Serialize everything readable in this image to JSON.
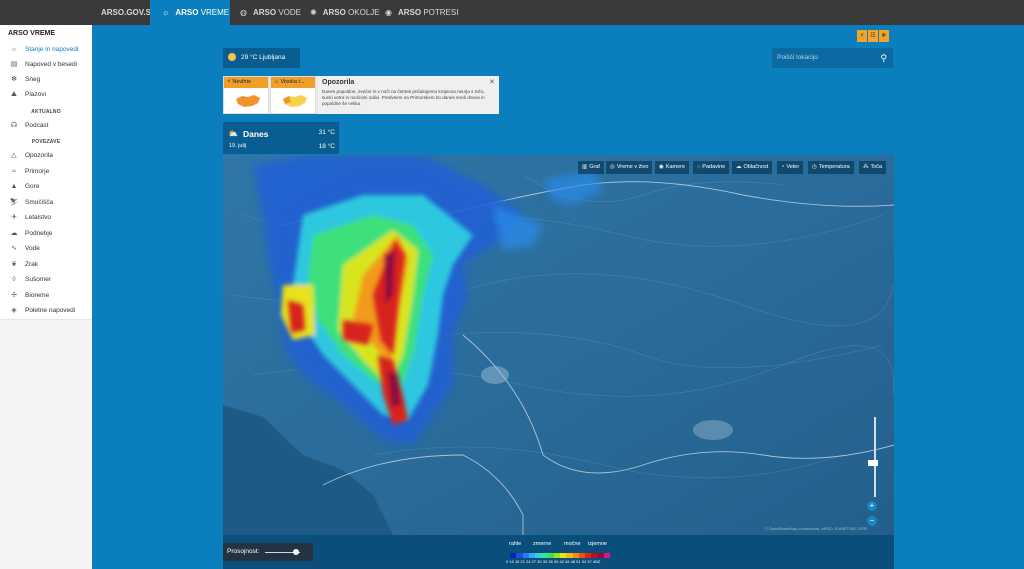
{
  "topbar": {
    "tabs": [
      {
        "brand": "ARSO.GOV.SI",
        "rest": ""
      },
      {
        "brand": "ARSO",
        "rest": " VREME"
      },
      {
        "brand": "ARSO",
        "rest": " VODE"
      },
      {
        "brand": "ARSO",
        "rest": " OKOLJE"
      },
      {
        "brand": "ARSO",
        "rest": " POTRESI"
      }
    ]
  },
  "sidebar": {
    "title": "ARSO VREME",
    "items": [
      "Stanje in napovedi",
      "Napoved v besedi",
      "Sneg",
      "Plazovi"
    ],
    "section_aktualno": "AKTUALNO",
    "aktualno_items": [
      "Podcast"
    ],
    "section_povezave": "POVEZAVE",
    "povezave_items": [
      "Opozorila",
      "Primorje",
      "Gore",
      "Smučišča",
      "Letalstvo",
      "Podnebje",
      "Vode",
      "Zrak",
      "Sušomer",
      "Bioreme",
      "Poletne napovedi"
    ]
  },
  "location": {
    "temp": "29 °C",
    "city": "Ljubljana"
  },
  "search": {
    "placeholder": "Poišči lokacijo"
  },
  "warning_icons": [
    "⚡",
    "☷",
    "❄"
  ],
  "warnings": {
    "card1_label": "Nevihte",
    "card2_label": "Visoka t...",
    "title": "Opozorila",
    "text": "Danes popoldne, zvečer in v noči na četrtek pričakujemo krajevna neurja s točo, sunki vetra in močnimi nalivi. Predvsem na Primorskem bo danes sredi dneva in popoldne še velika"
  },
  "today": {
    "day": "Danes",
    "date": "19. julij",
    "tmax": "31 °C",
    "tmin": "18 °C"
  },
  "map_tools": [
    "Graf",
    "Vreme v živo",
    "Kamere",
    "Padavine",
    "Oblačnost",
    "Veter",
    "Temperatura",
    "Toča"
  ],
  "map_attribution": "© OpenStreetMap contributors, ARSO, EUMETSAT, ESRI",
  "opacity_label": "Prosojnost:",
  "legend": {
    "categories": [
      "rahle",
      "zmerne",
      "močne",
      "izjemne"
    ],
    "values": "0  15  18  21  24  27  30  33  36  39  42  45  48  51  54  57  dBZ",
    "colors": [
      "#0a23b3",
      "#1a4fe0",
      "#2a7df0",
      "#37a8f5",
      "#2fd0e0",
      "#35e39a",
      "#47e04a",
      "#9be12a",
      "#e6e31b",
      "#f5b81a",
      "#f58a16",
      "#ee5212",
      "#d8241a",
      "#b3122a",
      "#8f0c3d",
      "#d11a8d"
    ]
  }
}
